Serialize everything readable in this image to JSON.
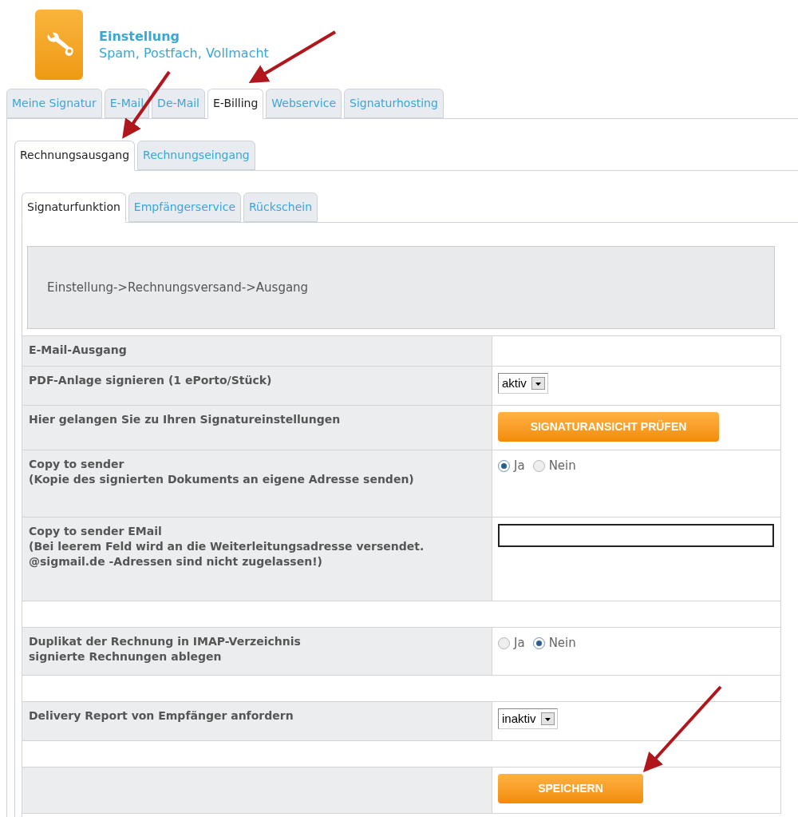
{
  "header": {
    "title": "Einstellung",
    "subtitle": "Spam, Postfach, Vollmacht"
  },
  "tabs": [
    {
      "label": "Meine Signatur",
      "selected": false
    },
    {
      "label": "E-Mail",
      "selected": false
    },
    {
      "label": "De-Mail",
      "selected": false
    },
    {
      "label": "E-Billing",
      "selected": true
    },
    {
      "label": "Webservice",
      "selected": false
    },
    {
      "label": "Signaturhosting",
      "selected": false
    }
  ],
  "subtabs": [
    {
      "label": "Rechnungsausgang",
      "selected": true
    },
    {
      "label": "Rechnungseingang",
      "selected": false
    }
  ],
  "section_tabs": [
    {
      "label": "Signaturfunktion",
      "selected": true
    },
    {
      "label": "Empfängerservice",
      "selected": false
    },
    {
      "label": "Rückschein",
      "selected": false
    }
  ],
  "breadcrumb": "Einstellung->Rechnungsversand->Ausgang",
  "form": {
    "rows": [
      {
        "kind": "heading",
        "label": "E-Mail-Ausgang"
      },
      {
        "kind": "select",
        "label": "PDF-Anlage signieren (1 ePorto/Stück)",
        "value": "aktiv"
      },
      {
        "kind": "button",
        "label": "Hier gelangen Sie zu Ihren Signatureinstellungen",
        "button": "SIGNATURANSICHT PRÜFEN"
      },
      {
        "kind": "radio",
        "label": "Copy to sender\n(Kopie des signierten Dokuments an eigene Adresse senden)",
        "options": [
          {
            "label": "Ja",
            "selected": true
          },
          {
            "label": "Nein",
            "selected": false
          }
        ]
      },
      {
        "kind": "input",
        "label": "Copy to sender EMail\n(Bei leerem Feld wird an die Weiterleitungsadresse versendet.\n@sigmail.de -Adressen sind nicht zugelassen!)"
      },
      {
        "kind": "spacer"
      },
      {
        "kind": "radio",
        "label": "Duplikat der Rechnung in IMAP-Verzeichnis\nsignierte Rechnungen ablegen",
        "options": [
          {
            "label": "Ja",
            "selected": false
          },
          {
            "label": "Nein",
            "selected": true
          }
        ]
      },
      {
        "kind": "spacer"
      },
      {
        "kind": "select",
        "label": "Delivery Report von Empfänger anfordern",
        "value": "inaktiv"
      },
      {
        "kind": "spacer"
      },
      {
        "kind": "button",
        "button": "SPEICHERN"
      }
    ]
  }
}
